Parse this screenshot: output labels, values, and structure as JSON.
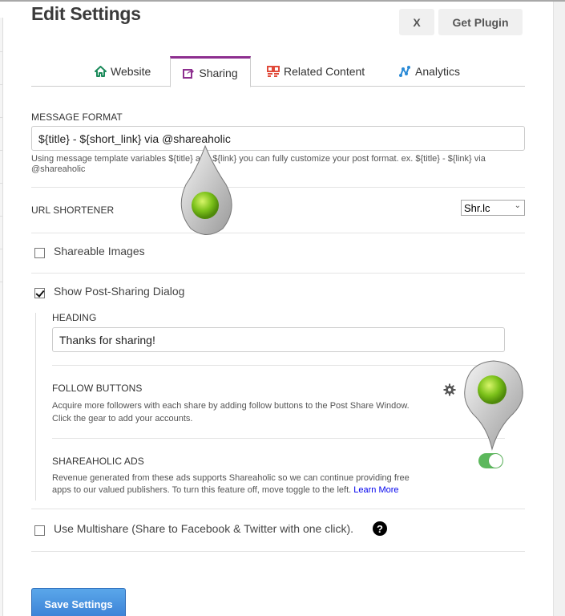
{
  "header": {
    "title": "Edit Settings",
    "close_label": "X",
    "get_plugin_label": "Get Plugin"
  },
  "tabs": [
    {
      "label": "Website",
      "icon": "home-icon",
      "active": false,
      "color": "#1a8a5a"
    },
    {
      "label": "Sharing",
      "icon": "share-icon",
      "active": true,
      "color": "#8d2f8f"
    },
    {
      "label": "Related Content",
      "icon": "related-content-icon",
      "active": false,
      "color": "#e04a3a"
    },
    {
      "label": "Analytics",
      "icon": "analytics-icon",
      "active": false,
      "color": "#2a8ad6"
    }
  ],
  "message_format": {
    "label": "MESSAGE FORMAT",
    "value": "${title} - ${short_link} via @shareaholic",
    "help": "Using message template variables ${title} and ${link} you can fully customize your post format. ex. ${title} - ${link} via @shareaholic"
  },
  "url_shortener": {
    "label": "URL SHORTENER",
    "selected": "Shr.lc"
  },
  "shareable_images": {
    "label": "Shareable Images",
    "checked": false
  },
  "post_sharing_dialog": {
    "label": "Show Post-Sharing Dialog",
    "checked": true,
    "heading_label": "HEADING",
    "heading_value": "Thanks for sharing!",
    "follow_buttons": {
      "label": "FOLLOW BUTTONS",
      "help_line1": "Acquire more followers with each share by adding follow buttons to the Post Share Window.",
      "help_line2": "Click the gear to add your accounts."
    },
    "ads": {
      "label": "SHAREAHOLIC ADS",
      "help_line1": "Revenue generated from these ads supports Shareaholic so we can continue providing free",
      "help_line2": "apps to our valued publishers. To turn this feature off, move toggle to the left.",
      "learn_more": "Learn More",
      "enabled": true
    }
  },
  "multishare": {
    "label": "Use Multishare (Share to Facebook & Twitter with one click).",
    "checked": false,
    "help_icon": "?"
  },
  "save_label": "Save Settings",
  "colors": {
    "accent_tab": "#8d2f8f",
    "toggle_on": "#5cb85c",
    "save_button": "#3a7fd5",
    "link": "#0000ee"
  }
}
